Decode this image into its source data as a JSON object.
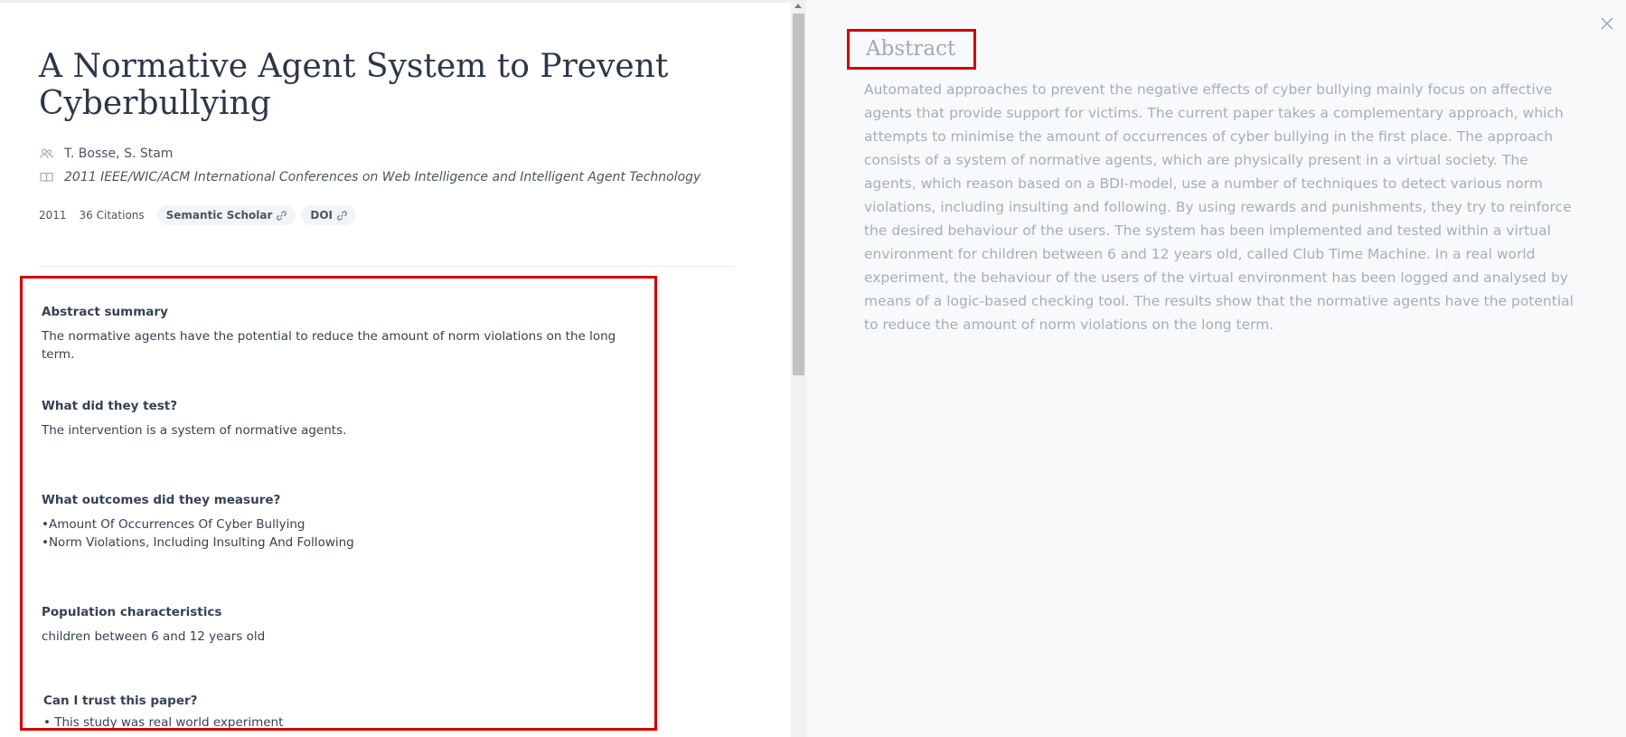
{
  "paper": {
    "title": "A Normative Agent System to Prevent Cyberbullying",
    "authors": "T. Bosse, S. Stam",
    "venue": "2011 IEEE/WIC/ACM International Conferences on Web Intelligence and Intelligent Agent Technology",
    "year": "2011",
    "citations": "36 Citations",
    "links": [
      "Semantic Scholar",
      "DOI"
    ]
  },
  "summary": {
    "abstract_summary": {
      "heading": "Abstract summary",
      "text": "The normative agents have the potential to reduce the amount of norm violations on the long term."
    },
    "tested": {
      "heading": "What did they test?",
      "text": "The intervention is a system of normative agents."
    },
    "outcomes": {
      "heading": "What outcomes did they measure?",
      "items": [
        "•Amount Of Occurrences Of Cyber Bullying",
        "•Norm Violations, Including Insulting And Following"
      ]
    },
    "population": {
      "heading": "Population characteristics",
      "text": "children between 6 and 12 years old"
    },
    "trust": {
      "heading": "Can I trust this paper?",
      "items": [
        "• This study was real world experiment"
      ]
    }
  },
  "abstract": {
    "heading": "Abstract",
    "text": "Automated approaches to prevent the negative effects of cyber bullying mainly focus on affective agents that provide support for victims. The current paper takes a complementary approach, which attempts to minimise the amount of occurrences of cyber bullying in the first place. The approach consists of a system of normative agents, which are physically present in a virtual society. The agents, which reason based on a BDI-model, use a number of techniques to detect various norm violations, including insulting and following. By using rewards and punishments, they try to reinforce the desired behaviour of the users. The system has been implemented and tested within a virtual environment for children between 6 and 12 years old, called Club Time Machine. In a real world experiment, the behaviour of the users of the virtual environment has been logged and analysed by means of a logic-based checking tool. The results show that the normative agents have the potential to reduce the amount of norm violations on the long term."
  },
  "icons": {
    "authors": "users-icon",
    "venue": "book-icon",
    "link": "link-icon",
    "close": "close-icon"
  },
  "colors": {
    "highlight": "#d10000",
    "panel_bg": "#f8f9fb",
    "pill_bg": "#f3f4f6"
  }
}
